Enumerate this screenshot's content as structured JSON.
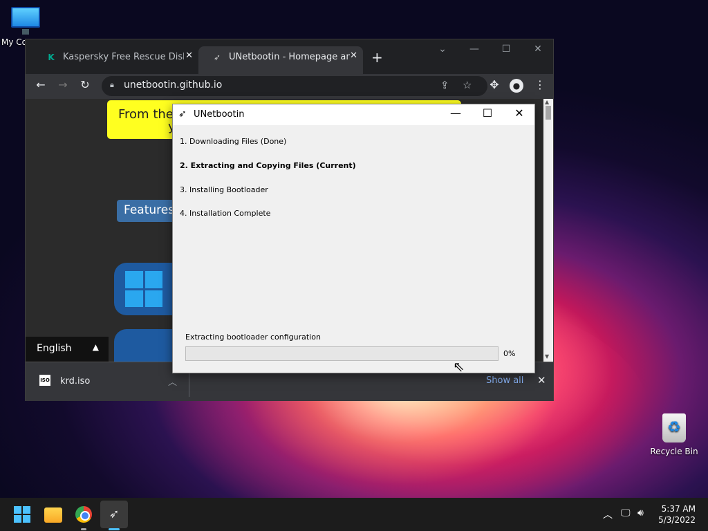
{
  "desktop": {
    "icons": [
      {
        "label": "My Co",
        "icon": "monitor-icon"
      },
      {
        "label": "Recycle Bin",
        "icon": "recycle-bin-icon"
      }
    ]
  },
  "browser": {
    "tabs": [
      {
        "title": "Kaspersky Free Rescue Disk | Kas",
        "icon": "kaspersky-icon"
      },
      {
        "title": "UNetbootin - Homepage and Do",
        "icon": "unetbootin-icon"
      }
    ],
    "url": "unetbootin.github.io",
    "page": {
      "banner_line1": "From the",
      "banner_line2": "y",
      "features_label": "Features",
      "language": "English"
    },
    "downloads": {
      "file_name": "krd.iso",
      "file_icon_text": "ISO",
      "show_all": "Show all"
    }
  },
  "dialog": {
    "title": "UNetbootin",
    "steps": [
      {
        "label": "1. Downloading Files (Done)",
        "current": false
      },
      {
        "label": "2. Extracting and Copying Files (Current)",
        "current": true
      },
      {
        "label": "3. Installing Bootloader",
        "current": false
      },
      {
        "label": "4. Installation Complete",
        "current": false
      }
    ],
    "status_text": "Extracting bootloader configuration",
    "progress_percent": 0,
    "progress_label": "0%"
  },
  "taskbar": {
    "apps": [
      "start-icon",
      "file-explorer-icon",
      "chrome-icon",
      "unetbootin-icon"
    ],
    "clock_time": "5:37 AM",
    "clock_date": "5/3/2022",
    "colors": {
      "accent": "#4cc2ff",
      "progress": "#06b025"
    }
  }
}
